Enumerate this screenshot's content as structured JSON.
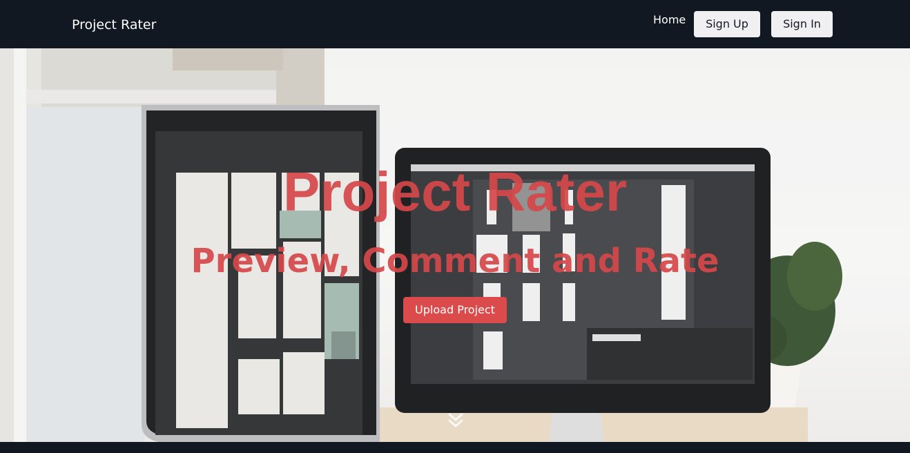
{
  "navbar": {
    "brand": "Project Rater",
    "home_label": "Home",
    "signup_label": "Sign Up",
    "signin_label": "Sign In"
  },
  "hero": {
    "title": "Project Rater",
    "subtitle": "Preview, Comment and Rate",
    "upload_label": "Upload Project",
    "background_image": "two-monitors-on-desk-photo",
    "scroll_icon": "double-chevron-down-icon"
  },
  "colors": {
    "navbar_bg": "#121821",
    "accent": "#dc4b4b",
    "nav_button_bg": "#f0f0f2"
  }
}
